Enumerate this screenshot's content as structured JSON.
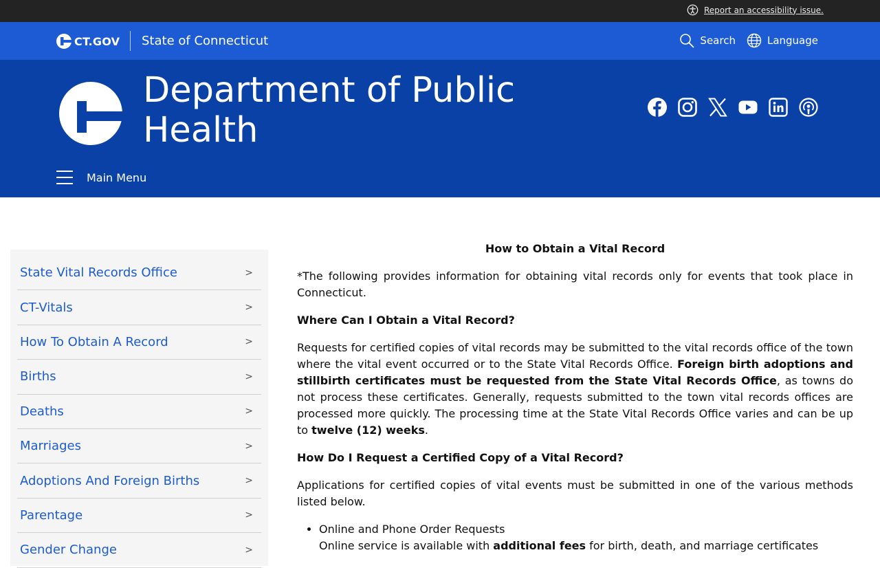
{
  "topbar": {
    "accessibility_link": "Report an accessibility issue."
  },
  "ctgov": {
    "logo_text": "CT.GOV",
    "state_name": "State of Connecticut",
    "search_label": "Search",
    "language_label": "Language"
  },
  "dph": {
    "title": "Department of Public Health",
    "main_menu_label": "Main Menu"
  },
  "social_icons": [
    "facebook-icon",
    "instagram-icon",
    "x-icon",
    "youtube-icon",
    "linkedin-icon",
    "podcast-icon"
  ],
  "sidebar": {
    "items": [
      {
        "label": "State Vital Records Office"
      },
      {
        "label": "CT-Vitals"
      },
      {
        "label": "How To Obtain A Record"
      },
      {
        "label": "Births"
      },
      {
        "label": "Deaths"
      },
      {
        "label": "Marriages"
      },
      {
        "label": "Adoptions And Foreign Births"
      },
      {
        "label": "Parentage"
      },
      {
        "label": "Gender Change"
      }
    ],
    "chevron": ">"
  },
  "content": {
    "heading": "How to Obtain a Vital Record",
    "intro": "*The following provides information for obtaining vital records only for events that took place in Connecticut.",
    "q1": "Where Can I Obtain a Vital Record?",
    "p1_a": "Requests for certified copies of vital records may be submitted to the vital records office of the town where the vital event occurred or to the State Vital Records Office. ",
    "p1_bold": "Foreign birth adoptions and stillbirth certificates must be requested from the State Vital Records Office",
    "p1_b": ", as towns do not process these certificates. Generally, requests submitted to the town vital records offices are processed more quickly. The processing time at the State Vital Records Office varies and can be up to ",
    "p1_bold2": "twelve (12) weeks",
    "p1_c": ".",
    "q2": "How Do I Request a Certified Copy of a Vital Record?",
    "p2": "Applications for certified copies of vital events must be submitted in one of the various methods listed below.",
    "list_item_1": "Online and Phone Order Requests",
    "list_item_1_sub_a": "Online service is available with ",
    "list_item_1_sub_bold": "additional fees",
    "list_item_1_sub_b": " for birth, death, and marriage certificates"
  },
  "colors": {
    "topbar": "#232323",
    "ctbar": "#1c5bd4",
    "dphbar": "#0a41a6",
    "link": "#1c5bd4",
    "sidebar_bg": "#f5f5f5"
  }
}
